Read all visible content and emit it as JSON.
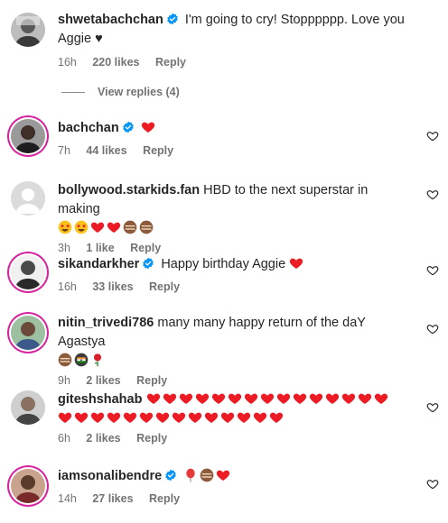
{
  "colors": {
    "heart": "#ed1c24",
    "verified": "#0095f6",
    "meta": "#737373",
    "text": "#262626"
  },
  "comments": [
    {
      "username": "shwetabachchan",
      "verified": true,
      "text": "I'm going to cry! Stopppppp. Love you Aggie ♥",
      "time": "16h",
      "likes": "220 likes",
      "reply": "Reply",
      "view_replies": "View replies (4)"
    },
    {
      "username": "bachchan",
      "verified": true,
      "text": "",
      "emojis": [
        "red-heart"
      ],
      "time": "7h",
      "likes": "44 likes",
      "reply": "Reply"
    },
    {
      "username": "bollywood.starkids.fan",
      "verified": false,
      "text": "HBD to the next superstar in making",
      "emojis": [
        "star-struck",
        "star-struck",
        "red-heart",
        "red-heart",
        "cake",
        "cake"
      ],
      "time": "3h",
      "likes": "1 like",
      "reply": "Reply"
    },
    {
      "username": "sikandarkher",
      "verified": true,
      "text": "Happy birthday Aggie",
      "emojis": [
        "red-heart"
      ],
      "time": "16h",
      "likes": "33 likes",
      "reply": "Reply"
    },
    {
      "username": "nitin_trivedi786",
      "verified": false,
      "text": "many many happy return of the daY Agastya",
      "emojis": [
        "cake",
        "flag",
        "rose"
      ],
      "time": "9h",
      "likes": "2 likes",
      "reply": "Reply"
    },
    {
      "username": "giteshshahab",
      "verified": false,
      "text": "",
      "emojis": [
        "red-heart x27"
      ],
      "time": "6h",
      "likes": "2 likes",
      "reply": "Reply"
    },
    {
      "username": "iamsonalibendre",
      "verified": true,
      "text": "",
      "emojis": [
        "balloon",
        "cake",
        "red-heart"
      ],
      "time": "14h",
      "likes": "27 likes",
      "reply": "Reply"
    }
  ]
}
